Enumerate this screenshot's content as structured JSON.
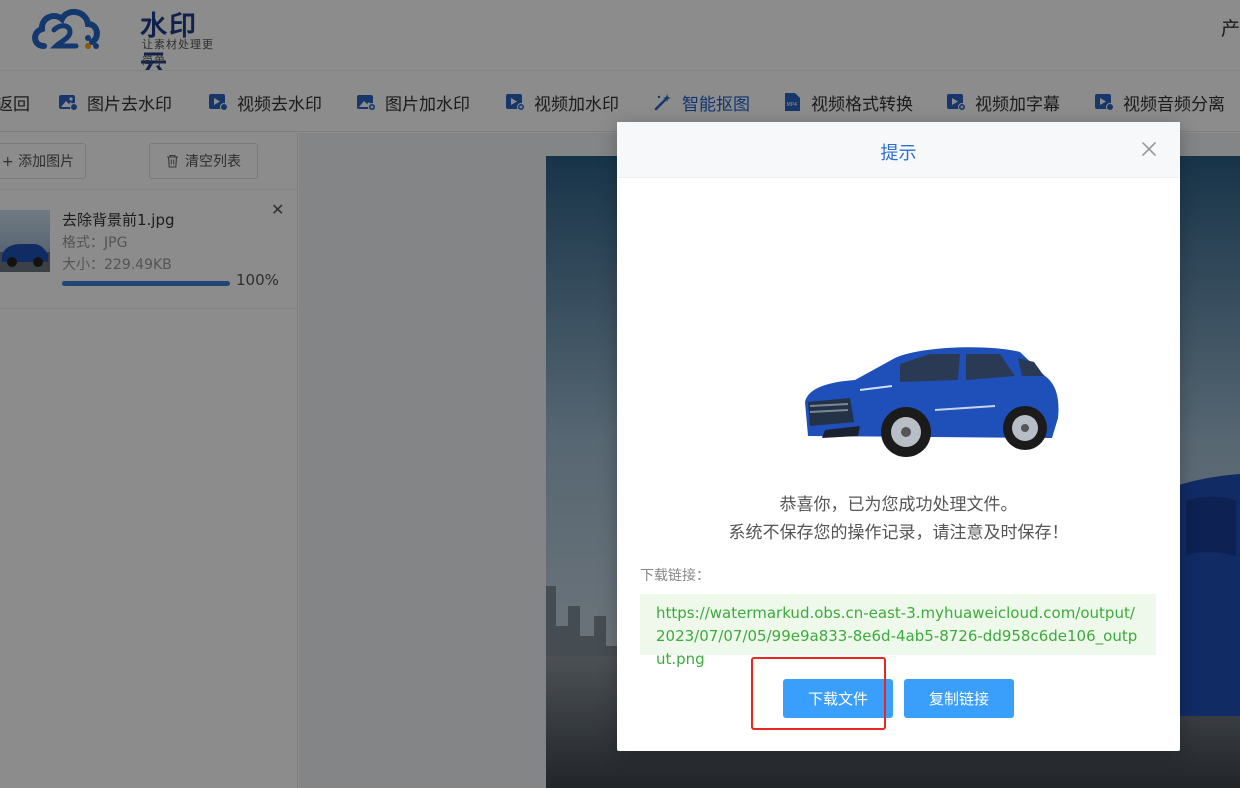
{
  "header": {
    "logo_text": "水印云",
    "logo_slogan": "让素材处理更简单",
    "right_text": "产"
  },
  "nav": {
    "items": [
      {
        "label": "返回",
        "icon": "back-icon"
      },
      {
        "label": "图片去水印",
        "icon": "image-remove-icon"
      },
      {
        "label": "视频去水印",
        "icon": "video-remove-icon"
      },
      {
        "label": "图片加水印",
        "icon": "image-add-icon"
      },
      {
        "label": "视频加水印",
        "icon": "video-add-icon"
      },
      {
        "label": "智能抠图",
        "icon": "magic-wand-icon",
        "active": true
      },
      {
        "label": "视频格式转换",
        "icon": "mp4-file-icon"
      },
      {
        "label": "视频加字幕",
        "icon": "video-subtitle-icon"
      },
      {
        "label": "视频音频分离",
        "icon": "video-audio-icon"
      }
    ]
  },
  "left_panel": {
    "add_button": "+ 添加图片",
    "clear_button": "清空列表",
    "file": {
      "name": "去除背景前1.jpg",
      "format": "格式：JPG",
      "size": "大小：229.49KB",
      "progress_label": "100%",
      "progress_fraction": 1.0
    }
  },
  "modal": {
    "title": "提示",
    "message_line1": "恭喜你，已为您成功处理文件。",
    "message_line2": "系统不保存您的操作记录，请注意及时保存！",
    "link_label": "下载链接：",
    "link_url": "https://watermarkud.obs.cn-east-3.myhuaweicloud.com/output/2023/07/07/05/99e9a833-8e6d-4ab5-8726-dd958c6de106_output.png",
    "download_button": "下载文件",
    "copy_button": "复制链接"
  },
  "colors": {
    "accent": "#1f5fcf",
    "primary_button": "#3a9efb",
    "link_text": "#3dab3b",
    "link_bg": "#eef9ec",
    "highlight": "#e8281e",
    "car": "#1f4fb8"
  }
}
